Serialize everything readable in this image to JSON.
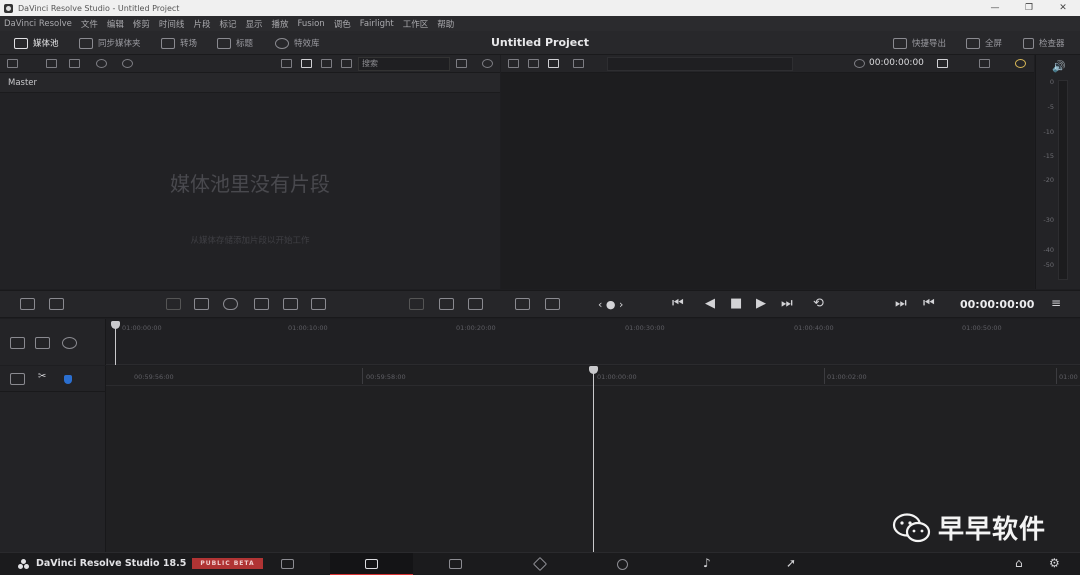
{
  "window": {
    "title": "DaVinci Resolve Studio - Untitled Project",
    "controls": [
      "—",
      "❐",
      "✕"
    ]
  },
  "menu": [
    "DaVinci Resolve",
    "文件",
    "编辑",
    "修剪",
    "时间线",
    "片段",
    "标记",
    "显示",
    "播放",
    "Fusion",
    "调色",
    "Fairlight",
    "工作区",
    "帮助"
  ],
  "toolbar": {
    "media_pool": "媒体池",
    "sync_bin": "同步媒体夹",
    "transitions": "转场",
    "titles": "标题",
    "effects": "特效库",
    "project_title": "Untitled Project",
    "quick_export": "快捷导出",
    "fullscreen": "全屏",
    "inspector": "检查器"
  },
  "media_pool": {
    "search_placeholder": "搜索",
    "bin": "Master",
    "empty_title": "媒体池里没有片段",
    "empty_hint": "从媒体存储添加片段以开始工作"
  },
  "viewer": {
    "timecode": "00:00:00:00"
  },
  "meters": {
    "labels": [
      "0",
      "-5",
      "-10",
      "-15",
      "-20",
      "-30",
      "-40",
      "-50"
    ]
  },
  "transport": {
    "timecode": "00:00:00:00"
  },
  "timeline_upper": {
    "ticks": [
      "01:00:00:00",
      "01:00:10:00",
      "01:00:20:00",
      "01:00:30:00",
      "01:00:40:00",
      "01:00:50:00"
    ]
  },
  "timeline_lower": {
    "ticks": [
      "00:59:56:00",
      "00:59:58:00",
      "01:00:00:00",
      "01:00:02:00",
      "01:00"
    ]
  },
  "watermark": {
    "text": "早早软件"
  },
  "bottom": {
    "app_name": "DaVinci Resolve Studio 18.5",
    "badge": "PUBLIC BETA"
  },
  "icons": [
    "app-icon",
    "media-pool-icon",
    "sync-bin-icon",
    "transitions-icon",
    "titles-icon",
    "effects-icon",
    "export-icon",
    "fullscreen-icon",
    "inspector-icon",
    "speaker-icon",
    "play-icon",
    "stop-icon",
    "home-icon",
    "gear-icon",
    "wechat-icon"
  ]
}
